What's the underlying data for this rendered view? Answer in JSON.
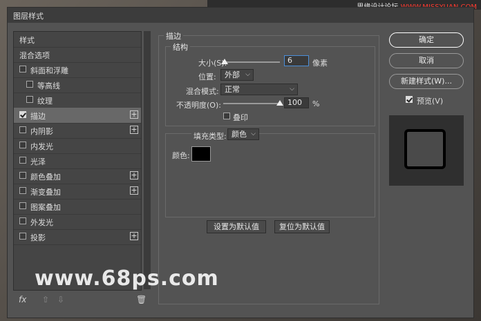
{
  "site": {
    "name_part1": "思缘设计论坛",
    "name_part2": "WWW.MISSYUAN.COM"
  },
  "watermark": "www.68ps.com",
  "dialog": {
    "title": "图层样式"
  },
  "sidebar": {
    "header": "样式",
    "blend_options": "混合选项",
    "items": [
      {
        "label": "斜面和浮雕",
        "checked": false,
        "plus": false
      },
      {
        "label": "等高线",
        "checked": false,
        "plus": false
      },
      {
        "label": "纹理",
        "checked": false,
        "plus": false
      },
      {
        "label": "描边",
        "checked": true,
        "plus": true,
        "selected": true
      },
      {
        "label": "内阴影",
        "checked": false,
        "plus": true
      },
      {
        "label": "内发光",
        "checked": false,
        "plus": false
      },
      {
        "label": "光泽",
        "checked": false,
        "plus": false
      },
      {
        "label": "颜色叠加",
        "checked": false,
        "plus": true
      },
      {
        "label": "渐变叠加",
        "checked": false,
        "plus": true
      },
      {
        "label": "图案叠加",
        "checked": false,
        "plus": false
      },
      {
        "label": "外发光",
        "checked": false,
        "plus": false
      },
      {
        "label": "投影",
        "checked": false,
        "plus": true
      }
    ],
    "plus_symbol": "+",
    "fx_label": "fx",
    "up_symbol": "⇧",
    "down_symbol": "⇩",
    "trash_symbol": "🗑"
  },
  "stroke": {
    "section_title": "描边",
    "structure_title": "结构",
    "size_label": "大小(S):",
    "size_value": "6",
    "size_unit": "像素",
    "size_fraction": 0.03,
    "position_label": "位置:",
    "position_value": "外部",
    "blend_label": "混合模式:",
    "blend_value": "正常",
    "opacity_label": "不透明度(O):",
    "opacity_value": "100",
    "opacity_unit": "%",
    "opacity_fraction": 1.0,
    "overprint_label": "叠印",
    "fill_type_label": "填充类型:",
    "fill_type_value": "颜色",
    "color_label": "颜色:",
    "color_value": "#000000",
    "set_default": "设置为默认值",
    "reset_default": "复位为默认值"
  },
  "right": {
    "ok": "确定",
    "cancel": "取消",
    "new_style": "新建样式(W)...",
    "preview_label": "预览(V)"
  },
  "icons": {
    "check": "check-icon",
    "plus": "plus-icon",
    "chevron": "chevron-down-icon"
  }
}
